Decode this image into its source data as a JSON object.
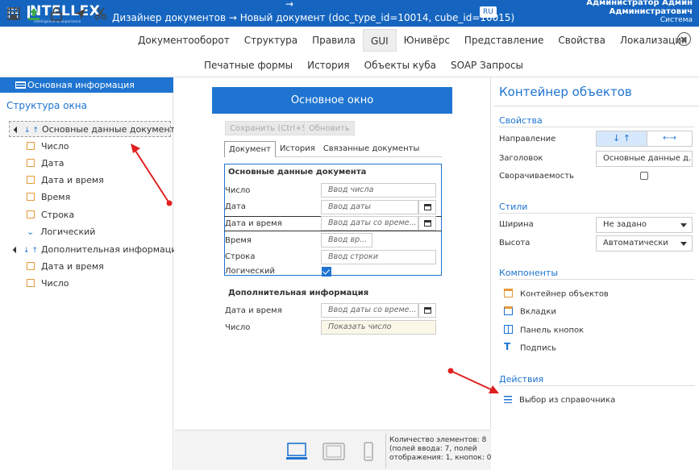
{
  "topbar": {
    "logo_text": "NTELLEX",
    "logo_sub": "intelligence & experience",
    "arrow": "→",
    "doc_title": "Дизайнер документов  →  Новый документ (doc_type_id=10014, cube_id=10015)",
    "lang": "RU",
    "user_line1": "Администратор Админ",
    "user_line2": "Администратович",
    "user_role": "Система"
  },
  "main_tabs": [
    "Документооборот",
    "Структура",
    "Правила",
    "GUI",
    "Юнивёрс",
    "Представление",
    "Свойства",
    "Локализация"
  ],
  "active_main_tab": "GUI",
  "sub_tabs": [
    "Печатные формы",
    "История",
    "Объекты куба",
    "SOAP Запросы"
  ],
  "left": {
    "selected": "Основная информация",
    "structure_label": "Структура окна",
    "tree": [
      {
        "label": "Основные данные документа",
        "kind": "group"
      },
      {
        "label": "Число",
        "kind": "num"
      },
      {
        "label": "Дата",
        "kind": "date"
      },
      {
        "label": "Дата и время",
        "kind": "date"
      },
      {
        "label": "Время",
        "kind": "time"
      },
      {
        "label": "Строка",
        "kind": "text"
      },
      {
        "label": "Логический",
        "kind": "bool"
      },
      {
        "label": "Дополнительная информация",
        "kind": "group"
      },
      {
        "label": "Дата и время",
        "kind": "date"
      },
      {
        "label": "Число",
        "kind": "num"
      }
    ]
  },
  "center": {
    "window_title": "Основное окно",
    "save_button": "Сохранить (Ctrl+S)",
    "refresh_button": "Обновить",
    "form_tabs": [
      "Документ",
      "История",
      "Связанные документы"
    ],
    "group1_title": "Основные данные документа",
    "group1_fields": [
      {
        "label": "Число",
        "placeholder": "Ввод числа"
      },
      {
        "label": "Дата",
        "placeholder": "Ввод даты"
      },
      {
        "label": "Дата и время",
        "placeholder": "Ввод даты со време..."
      },
      {
        "label": "Время",
        "placeholder": "Ввод вр..."
      },
      {
        "label": "Строка",
        "placeholder": "Ввод строки"
      },
      {
        "label": "Логический",
        "placeholder": ""
      }
    ],
    "group2_title": "Дополнительная информация",
    "group2_fields": [
      {
        "label": "Дата и время",
        "placeholder": "Ввод даты со време..."
      },
      {
        "label": "Число",
        "placeholder": "Показать число"
      }
    ],
    "count_text_1": "Количество элементов: 8",
    "count_text_2": "(полей ввода: 7, полей",
    "count_text_3": "отображения: 1, кнопок: 0)"
  },
  "right": {
    "title": "Контейнер объектов",
    "properties_head": "Свойства",
    "direction_label": "Направление",
    "direction_vertical": "↓ ↑",
    "direction_horizontal": "←→",
    "caption_label": "Заголовок",
    "caption_value": "Основные данные д...",
    "collapsible_label": "Сворачиваемость",
    "styles_head": "Стили",
    "width_label": "Ширина",
    "width_value": "Не задано",
    "height_label": "Высота",
    "height_value": "Автоматически",
    "components_head": "Компоненты",
    "components": [
      "Контейнер объектов",
      "Вкладки",
      "Панель кнопок",
      "Подпись"
    ],
    "actions_head": "Действия",
    "actions": [
      "Выбор из справочника"
    ]
  },
  "colors": {
    "accent": "#1e74d0",
    "topbar": "#1565c0",
    "annotation": "#e02020"
  }
}
